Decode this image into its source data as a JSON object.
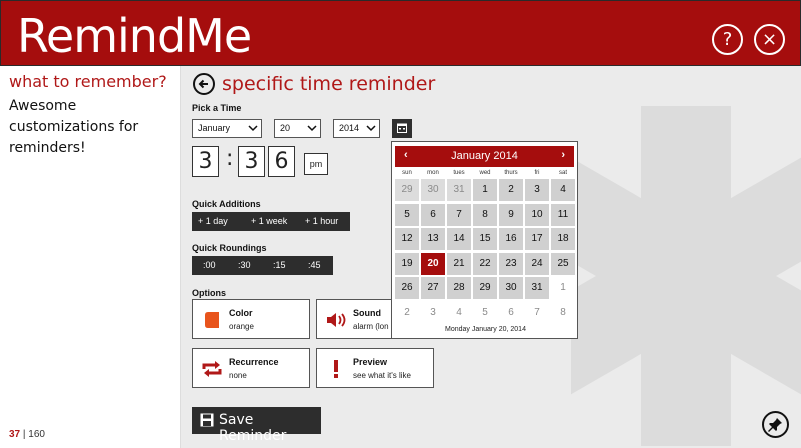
{
  "app": {
    "title": "RemindMe",
    "help_glyph": "?",
    "close_glyph": "×"
  },
  "sidebar": {
    "heading": "what to remember?",
    "text": "Awesome customizations for reminders!",
    "counter_current": "37",
    "counter_sep": " | ",
    "counter_total": "160"
  },
  "page": {
    "title": "specific time reminder",
    "pick_time_label": "Pick a Time",
    "month": "January",
    "day": "20",
    "year": "2014",
    "hour": "3",
    "minute_tens": "3",
    "minute_ones": "6",
    "colon": ":",
    "ampm": "pm",
    "quick_additions_label": "Quick Additions",
    "quick_additions": [
      "+ 1 day",
      "+ 1 week",
      "+ 1 hour"
    ],
    "quick_roundings_label": "Quick Roundings",
    "quick_roundings": [
      ":00",
      ":30",
      ":15",
      ":45"
    ],
    "options_label": "Options",
    "options": {
      "color": {
        "title": "Color",
        "sub": "orange"
      },
      "sound": {
        "title": "Sound",
        "sub": "alarm (lon"
      },
      "recurrence": {
        "title": "Recurrence",
        "sub": "none"
      },
      "preview": {
        "title": "Preview",
        "sub": "see what it's like"
      }
    },
    "save_label": "Save Reminder"
  },
  "calendar": {
    "month_label": "January 2014",
    "prev_glyph": "‹",
    "next_glyph": "›",
    "weekdays": [
      "sun",
      "mon",
      "tues",
      "wed",
      "thurs",
      "fri",
      "sat"
    ],
    "weeks": [
      [
        "29",
        "30",
        "31",
        "1",
        "2",
        "3",
        "4"
      ],
      [
        "5",
        "6",
        "7",
        "8",
        "9",
        "10",
        "11"
      ],
      [
        "12",
        "13",
        "14",
        "15",
        "16",
        "17",
        "18"
      ],
      [
        "19",
        "20",
        "21",
        "22",
        "23",
        "24",
        "25"
      ],
      [
        "26",
        "27",
        "28",
        "29",
        "30",
        "31",
        "1"
      ],
      [
        "2",
        "3",
        "4",
        "5",
        "6",
        "7",
        "8"
      ]
    ],
    "selected_date": "20",
    "footer": "Monday January 20, 2014"
  },
  "colors": {
    "accent": "#a50d0d",
    "orange": "#e8541c",
    "dark": "#2d2d2d"
  }
}
